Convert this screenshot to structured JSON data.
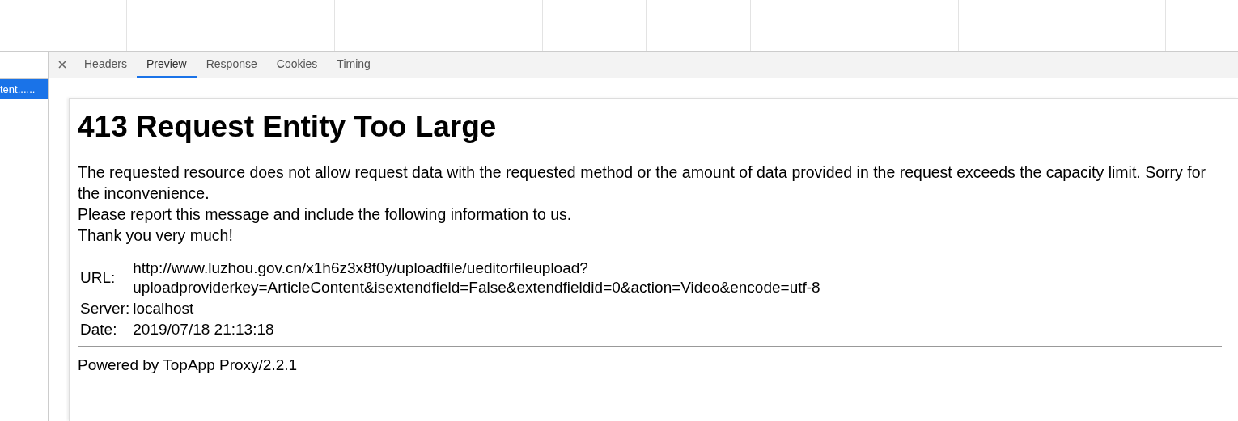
{
  "sidebar": {
    "items": [
      {
        "label": "tent......",
        "selected": true
      }
    ]
  },
  "tabs": [
    {
      "label": "Headers",
      "selected": false
    },
    {
      "label": "Preview",
      "selected": true
    },
    {
      "label": "Response",
      "selected": false
    },
    {
      "label": "Cookies",
      "selected": false
    },
    {
      "label": "Timing",
      "selected": false
    }
  ],
  "preview": {
    "heading": "413 Request Entity Too Large",
    "paragraphs": [
      "The requested resource does not allow request data with the requested method or the amount of data provided in the request exceeds the capacity limit. Sorry for the inconvenience.",
      "Please report this message and include the following information to us.",
      "Thank you very much!"
    ],
    "info": [
      {
        "label": "URL:",
        "value_lines": [
          "http://www.luzhou.gov.cn/x1h6z3x8f0y/uploadfile/ueditorfileupload?",
          "uploadproviderkey=ArticleContent&isextendfield=False&extendfieldid=0&action=Video&encode=utf-8"
        ]
      },
      {
        "label": "Server:",
        "value_lines": [
          "localhost"
        ]
      },
      {
        "label": "Date:",
        "value_lines": [
          "2019/07/18 21:13:18"
        ]
      }
    ],
    "footer": "Powered by TopApp Proxy/2.2.1"
  }
}
